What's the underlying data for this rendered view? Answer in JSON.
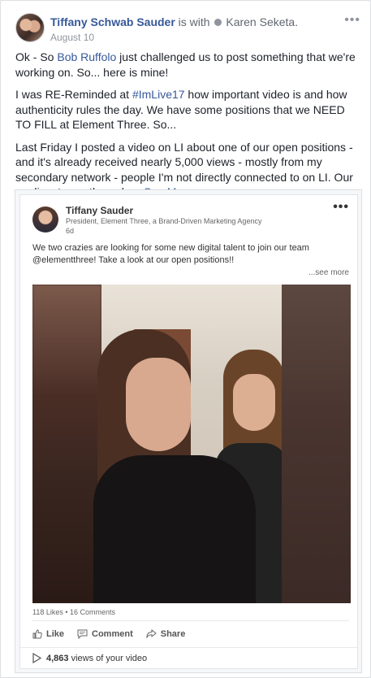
{
  "header": {
    "author": "Tiffany Schwab Sauder",
    "with_text": "is with",
    "tagged": "Karen Seketa.",
    "date": "August 10",
    "more_icon": "ellipsis-icon"
  },
  "body": {
    "p1_a": "Ok - So ",
    "p1_link": "Bob Ruffolo",
    "p1_b": " just challenged us to post something that we're working on. So... here is mine!",
    "p2_a": "I was RE-Reminded at ",
    "p2_link": "#ImLive17",
    "p2_b": " how important video is and how authenticity rules the day. We have some positions that we NEED TO FILL at Element Three. So...",
    "p3": "Last Friday I posted a video on LI about one of our open positions - and it's already received nearly 5,000 views - mostly from my secondary network - people I'm not directly connected to on LI. Our applicants are through ... ",
    "see_more": "See More"
  },
  "embed": {
    "name": "Tiffany Sauder",
    "title": "President, Element Three, a Brand-Driven Marketing Agency",
    "time": "6d",
    "text": "We two crazies are looking for some new digital talent to join our team @elementthree! Take a look at our open positions!!",
    "see_more": "...see more",
    "stats": "118 Likes • 16 Comments",
    "actions": {
      "like": "Like",
      "comment": "Comment",
      "share": "Share"
    },
    "views_count": "4,863",
    "views_text": "views of your video"
  },
  "colors": {
    "link": "#365899",
    "meta": "#90949c",
    "text": "#1d2129"
  }
}
